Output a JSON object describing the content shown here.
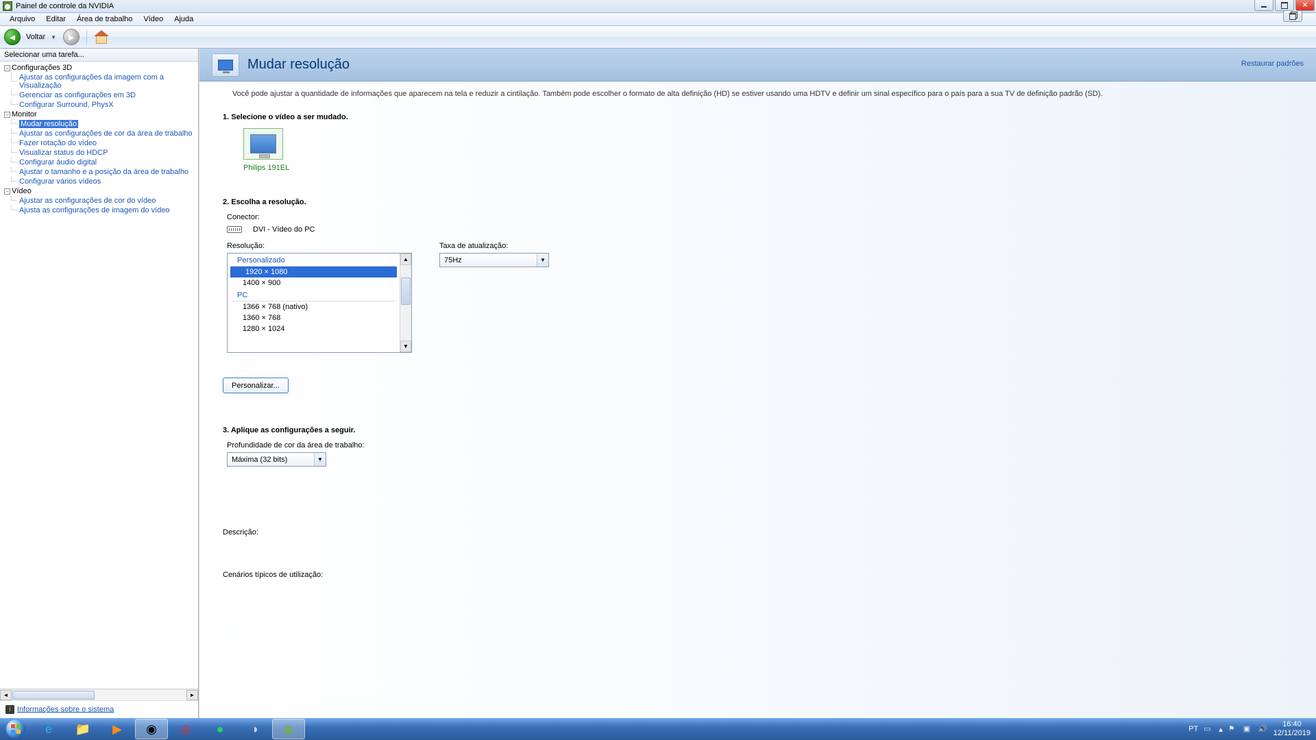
{
  "window": {
    "title": "Painel de controle da NVIDIA"
  },
  "menu": {
    "items": [
      "Arquivo",
      "Editar",
      "Área de trabalho",
      "Vídeo",
      "Ajuda"
    ]
  },
  "nav": {
    "back": "Voltar"
  },
  "sidebar": {
    "header": "Selecionar uma tarefa...",
    "cat1": {
      "label": "Configurações 3D",
      "items": [
        "Ajustar as configurações da imagem com a Visualização",
        "Gerenciar as configurações em 3D",
        "Configurar Surround, PhysX"
      ]
    },
    "cat2": {
      "label": "Monitor",
      "items": [
        "Mudar resolução",
        "Ajustar as configurações de cor da área de trabalho",
        "Fazer rotação do vídeo",
        "Visualizar status do HDCP",
        "Configurar áudio digital",
        "Ajustar o tamanho e a posição da área de trabalho",
        "Configurar vários vídeos"
      ]
    },
    "cat3": {
      "label": "Vídeo",
      "items": [
        "Ajustar as configurações de cor do vídeo",
        "Ajusta as configurações de imagem do vídeo"
      ]
    },
    "sysinfo": "Informações sobre o sistema"
  },
  "main": {
    "title": "Mudar resolução",
    "restore": "Restaurar padrões",
    "intro": "Você pode ajustar a quantidade de informações que aparecem na tela e reduzir a cintilação. Também pode escolher o formato de alta definição (HD) se estiver usando uma HDTV e definir um sinal específico para o país para a sua TV de definição padrão (SD).",
    "step1": "1. Selecione o vídeo a ser mudado.",
    "display_name": "Philips 191EL",
    "step2": "2. Escolha a resolução.",
    "connector_label": "Conector:",
    "connector_value": "DVI - Vídeo do PC",
    "resolution_label": "Resolução:",
    "refresh_label": "Taxa de atualização:",
    "refresh_value": "75Hz",
    "res_groups": {
      "g1": "Personalizado",
      "g2": "PC"
    },
    "res_opts": [
      "1920 × 1080",
      "1400 × 900",
      "1366 × 768 (nativo)",
      "1360 × 768",
      "1280 × 1024"
    ],
    "customize_btn": "Personalizar...",
    "step3": "3. Aplique as configurações a seguir.",
    "colordepth_label": "Profundidade de cor da área de trabalho:",
    "colordepth_value": "Máxima (32 bits)",
    "desc_label": "Descrição:",
    "scenarios_label": "Cenários típicos de utilização:"
  },
  "tray": {
    "lang": "PT",
    "time": "16:40",
    "date": "12/11/2019"
  }
}
